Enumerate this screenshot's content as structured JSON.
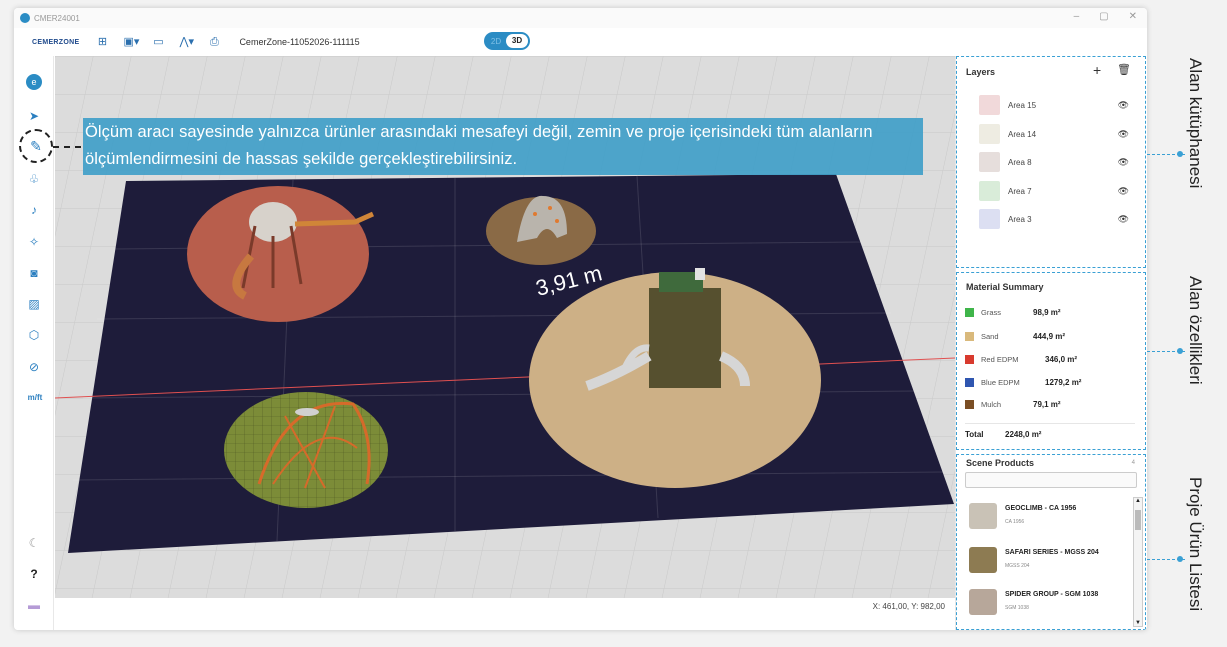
{
  "window": {
    "title": "CMER24001"
  },
  "toolbar": {
    "logo": "CEMERZONE",
    "project_name": "CemerZone-11052026-111115",
    "view_toggle": {
      "option_2d": "2D",
      "option_3d": "3D",
      "active": "3D"
    },
    "icons": [
      "new-file-icon",
      "save-icon",
      "open-folder-icon",
      "share-icon",
      "export-pdf-icon"
    ]
  },
  "sidebar": {
    "icons": [
      "app-logo-icon",
      "select-pointer-icon",
      "ruler-icon",
      "shapes-icon",
      "bell-icon",
      "effects-icon",
      "camera-icon",
      "image-icon",
      "cube-icon",
      "hide-icon",
      "units-toggle-icon",
      "moon-icon",
      "help-icon",
      "keyboard-icon"
    ],
    "units_label": "m/ft",
    "help_label": "?"
  },
  "viewport": {
    "measurement_label": "3,91 m",
    "coordinates": "X: 461,00, Y: 982,00"
  },
  "callout": {
    "text": "Ölçüm aracı sayesinde yalnızca ürünler arasındaki mesafeyi değil, zemin ve proje içerisindeki tüm alanların ölçümlendirmesini de hassas şekilde gerçekleştirebilirsiniz."
  },
  "layers": {
    "title": "Layers",
    "add_label": "+",
    "items": [
      {
        "name": "Area 15",
        "color": "#f1d9da"
      },
      {
        "name": "Area 14",
        "color": "#eeece2"
      },
      {
        "name": "Area 8",
        "color": "#e6dedc"
      },
      {
        "name": "Area 7",
        "color": "#d9ecd9"
      },
      {
        "name": "Area 3",
        "color": "#dcdff2"
      }
    ]
  },
  "material_summary": {
    "title": "Material Summary",
    "items": [
      {
        "name": "Grass",
        "value": "98,9 m²",
        "color": "#3fb54a"
      },
      {
        "name": "Sand",
        "value": "444,9 m²",
        "color": "#d9b97c"
      },
      {
        "name": "Red EDPM",
        "value": "346,0 m²",
        "color": "#d83a2e"
      },
      {
        "name": "Blue EDPM",
        "value": "1279,2 m²",
        "color": "#2f56b0"
      },
      {
        "name": "Mulch",
        "value": "79,1 m²",
        "color": "#7a4e24"
      }
    ],
    "total_label": "Total",
    "total_value": "2248,0 m²"
  },
  "scene_products": {
    "title": "Scene Products",
    "count": "4",
    "search_placeholder": "",
    "items": [
      {
        "name": "GEOCLIMB - CA 1956",
        "code": "CA 1956",
        "thumb_color": "#c9c2b6"
      },
      {
        "name": "SAFARI SERIES - MGSS 204",
        "code": "MGSS 204",
        "thumb_color": "#8d7b52"
      },
      {
        "name": "SPIDER GROUP - SGM 1038",
        "code": "SGM 1038",
        "thumb_color": "#b7a79a"
      }
    ]
  },
  "captions": {
    "layers": "Alan kütüphanesi",
    "material": "Alan özellikleri",
    "products": "Proje Ürün Listesi"
  },
  "colors": {
    "accent": "#2b8cc4",
    "callout_bg": "#409ec8",
    "floor": "#1e1c3a",
    "dashed_border": "#3aa0d4"
  }
}
